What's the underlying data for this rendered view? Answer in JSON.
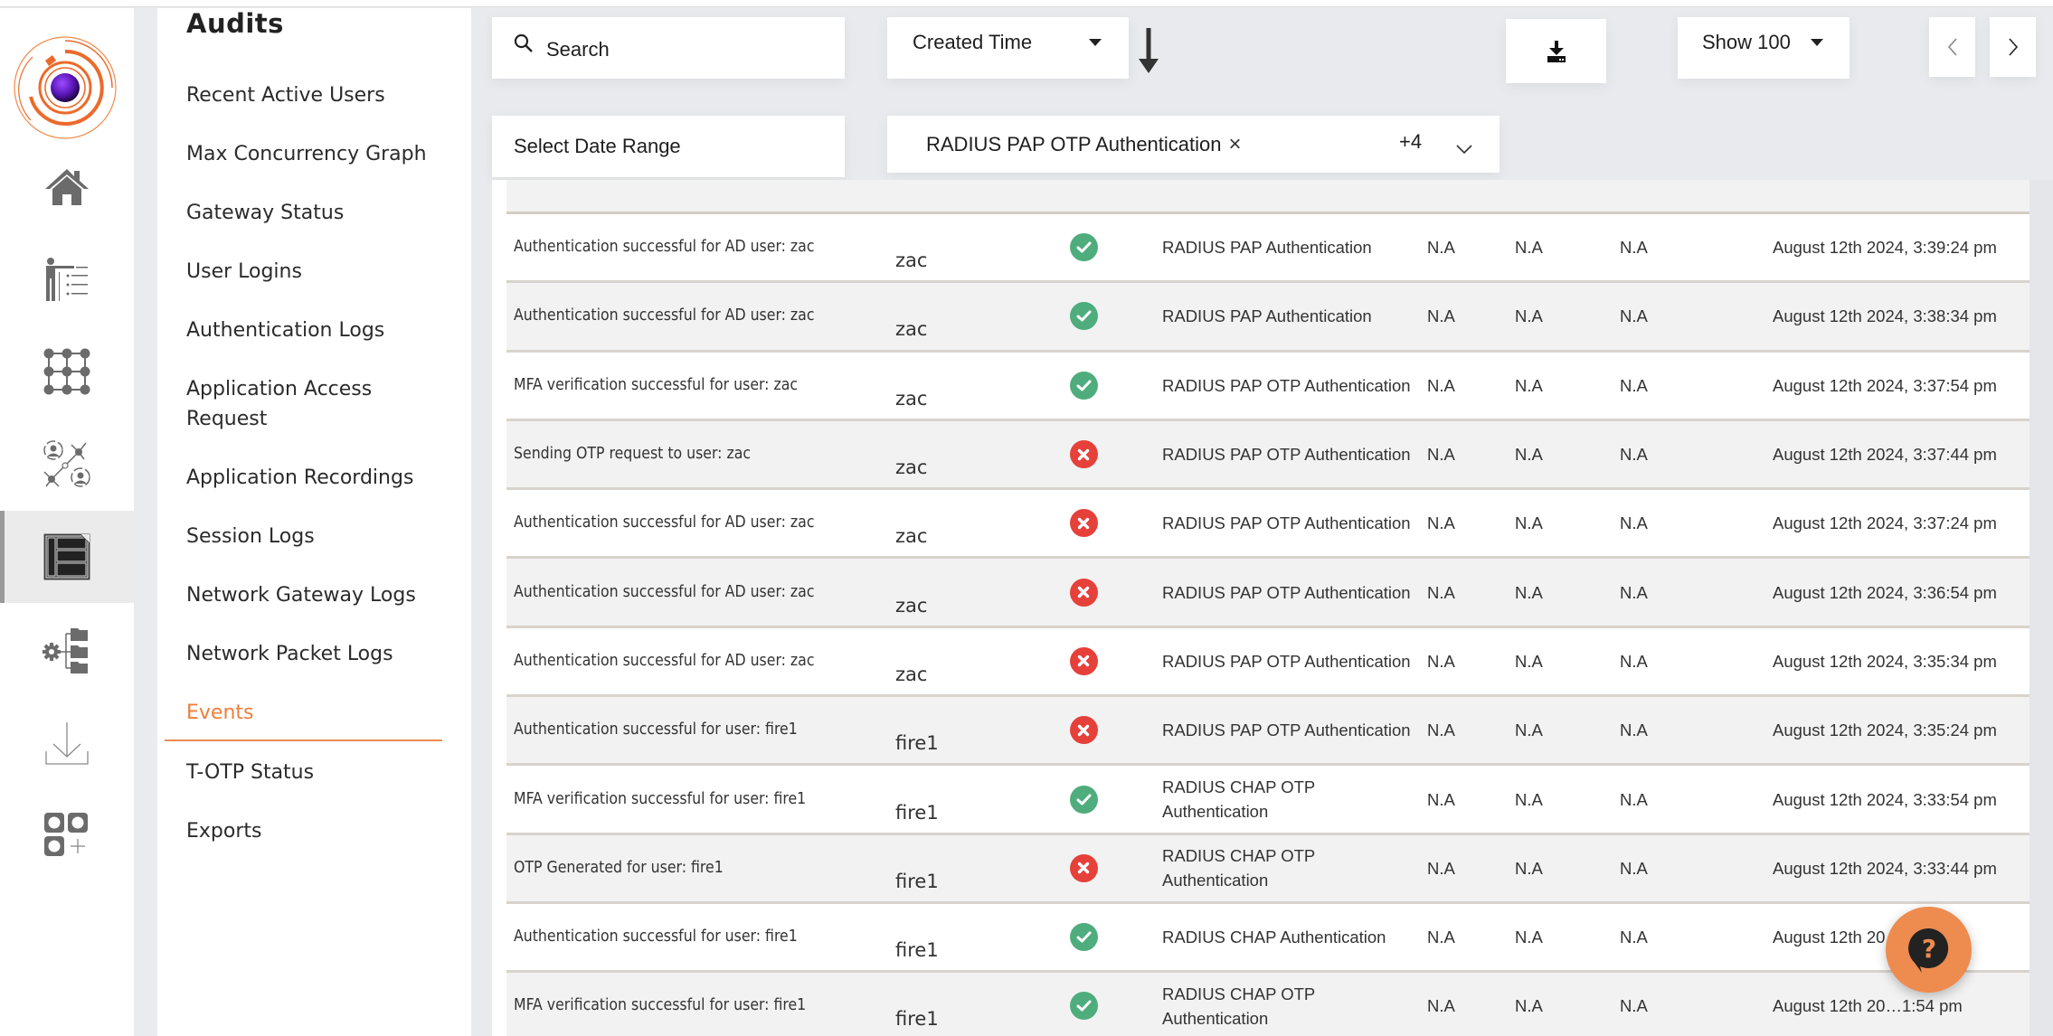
{
  "brand": {
    "accent": "#ef7d3b",
    "success": "#4fad7d",
    "error": "#e5413a"
  },
  "rail": {
    "items": [
      {
        "icon": "home-icon",
        "label": "Home"
      },
      {
        "icon": "presenter-list-icon",
        "label": "Users"
      },
      {
        "icon": "grid-network-icon",
        "label": "Applications"
      },
      {
        "icon": "user-network-icon",
        "label": "Groups"
      },
      {
        "icon": "audit-log-icon",
        "label": "Audits",
        "active": true
      },
      {
        "icon": "settings-tree-icon",
        "label": "Settings"
      },
      {
        "icon": "download-tray-icon",
        "label": "Downloads"
      },
      {
        "icon": "add-apps-icon",
        "label": "Add-ons"
      }
    ]
  },
  "submenu": {
    "title": "Audits",
    "items": [
      {
        "label": "Recent Active Users"
      },
      {
        "label": "Max Concurrency Graph"
      },
      {
        "label": "Gateway Status"
      },
      {
        "label": "User Logins"
      },
      {
        "label": "Authentication Logs"
      },
      {
        "label": "Application Access Request"
      },
      {
        "label": "Application Recordings"
      },
      {
        "label": "Session Logs"
      },
      {
        "label": "Network Gateway Logs"
      },
      {
        "label": "Network Packet Logs"
      },
      {
        "label": "Events",
        "active": true
      },
      {
        "label": "T-OTP Status"
      },
      {
        "label": "Exports"
      }
    ]
  },
  "toolbar": {
    "search_placeholder": "Search",
    "sort_field": "Created Time",
    "sort_direction": "descending",
    "page_size": "Show 100",
    "date_range_placeholder": "Select Date Range",
    "event_filter": {
      "selected": "RADIUS PAP OTP Authentication",
      "more_count": "+4"
    },
    "prev_label": "‹",
    "next_label": "›"
  },
  "table": {
    "rows": [
      {
        "description": "Authentication successful for AD user: zac",
        "user": "zac",
        "status": "success",
        "type": "RADIUS PAP Authentication",
        "col1": "N.A",
        "col2": "N.A",
        "col3": "N.A",
        "time": "August 12th 2024, 3:39:24 pm"
      },
      {
        "description": "Authentication successful for AD user: zac",
        "user": "zac",
        "status": "success",
        "type": "RADIUS PAP Authentication",
        "col1": "N.A",
        "col2": "N.A",
        "col3": "N.A",
        "time": "August 12th 2024, 3:38:34 pm"
      },
      {
        "description": "MFA verification successful for user: zac",
        "user": "zac",
        "status": "success",
        "type": "RADIUS PAP OTP Authentication",
        "col1": "N.A",
        "col2": "N.A",
        "col3": "N.A",
        "time": "August 12th 2024, 3:37:54 pm"
      },
      {
        "description": "Sending OTP request to user: zac",
        "user": "zac",
        "status": "failure",
        "type": "RADIUS PAP OTP Authentication",
        "col1": "N.A",
        "col2": "N.A",
        "col3": "N.A",
        "time": "August 12th 2024, 3:37:44 pm"
      },
      {
        "description": "Authentication successful for AD user: zac",
        "user": "zac",
        "status": "failure",
        "type": "RADIUS PAP OTP Authentication",
        "col1": "N.A",
        "col2": "N.A",
        "col3": "N.A",
        "time": "August 12th 2024, 3:37:24 pm"
      },
      {
        "description": "Authentication successful for AD user: zac",
        "user": "zac",
        "status": "failure",
        "type": "RADIUS PAP OTP Authentication",
        "col1": "N.A",
        "col2": "N.A",
        "col3": "N.A",
        "time": "August 12th 2024, 3:36:54 pm"
      },
      {
        "description": "Authentication successful for AD user: zac",
        "user": "zac",
        "status": "failure",
        "type": "RADIUS PAP OTP Authentication",
        "col1": "N.A",
        "col2": "N.A",
        "col3": "N.A",
        "time": "August 12th 2024, 3:35:34 pm"
      },
      {
        "description": "Authentication successful for user: fire1",
        "user": "fire1",
        "status": "failure",
        "type": "RADIUS PAP OTP Authentication",
        "col1": "N.A",
        "col2": "N.A",
        "col3": "N.A",
        "time": "August 12th 2024, 3:35:24 pm"
      },
      {
        "description": "MFA verification successful for user: fire1",
        "user": "fire1",
        "status": "success",
        "type": "RADIUS CHAP OTP Authentication",
        "col1": "N.A",
        "col2": "N.A",
        "col3": "N.A",
        "time": "August 12th 2024, 3:33:54 pm"
      },
      {
        "description": "OTP Generated for user: fire1",
        "user": "fire1",
        "status": "failure",
        "type": "RADIUS CHAP OTP Authentication",
        "col1": "N.A",
        "col2": "N.A",
        "col3": "N.A",
        "time": "August 12th 2024, 3:33:44 pm"
      },
      {
        "description": "Authentication successful for user: fire1",
        "user": "fire1",
        "status": "success",
        "type": "RADIUS CHAP Authentication",
        "col1": "N.A",
        "col2": "N.A",
        "col3": "N.A",
        "time": "August 12th 20…:04 pm"
      },
      {
        "description": "MFA verification successful for user: fire1",
        "user": "fire1",
        "status": "success",
        "type": "RADIUS CHAP OTP Authentication",
        "col1": "N.A",
        "col2": "N.A",
        "col3": "N.A",
        "time": "August 12th 20…1:54 pm"
      }
    ]
  },
  "help": {
    "icon": "help-chat-icon"
  }
}
